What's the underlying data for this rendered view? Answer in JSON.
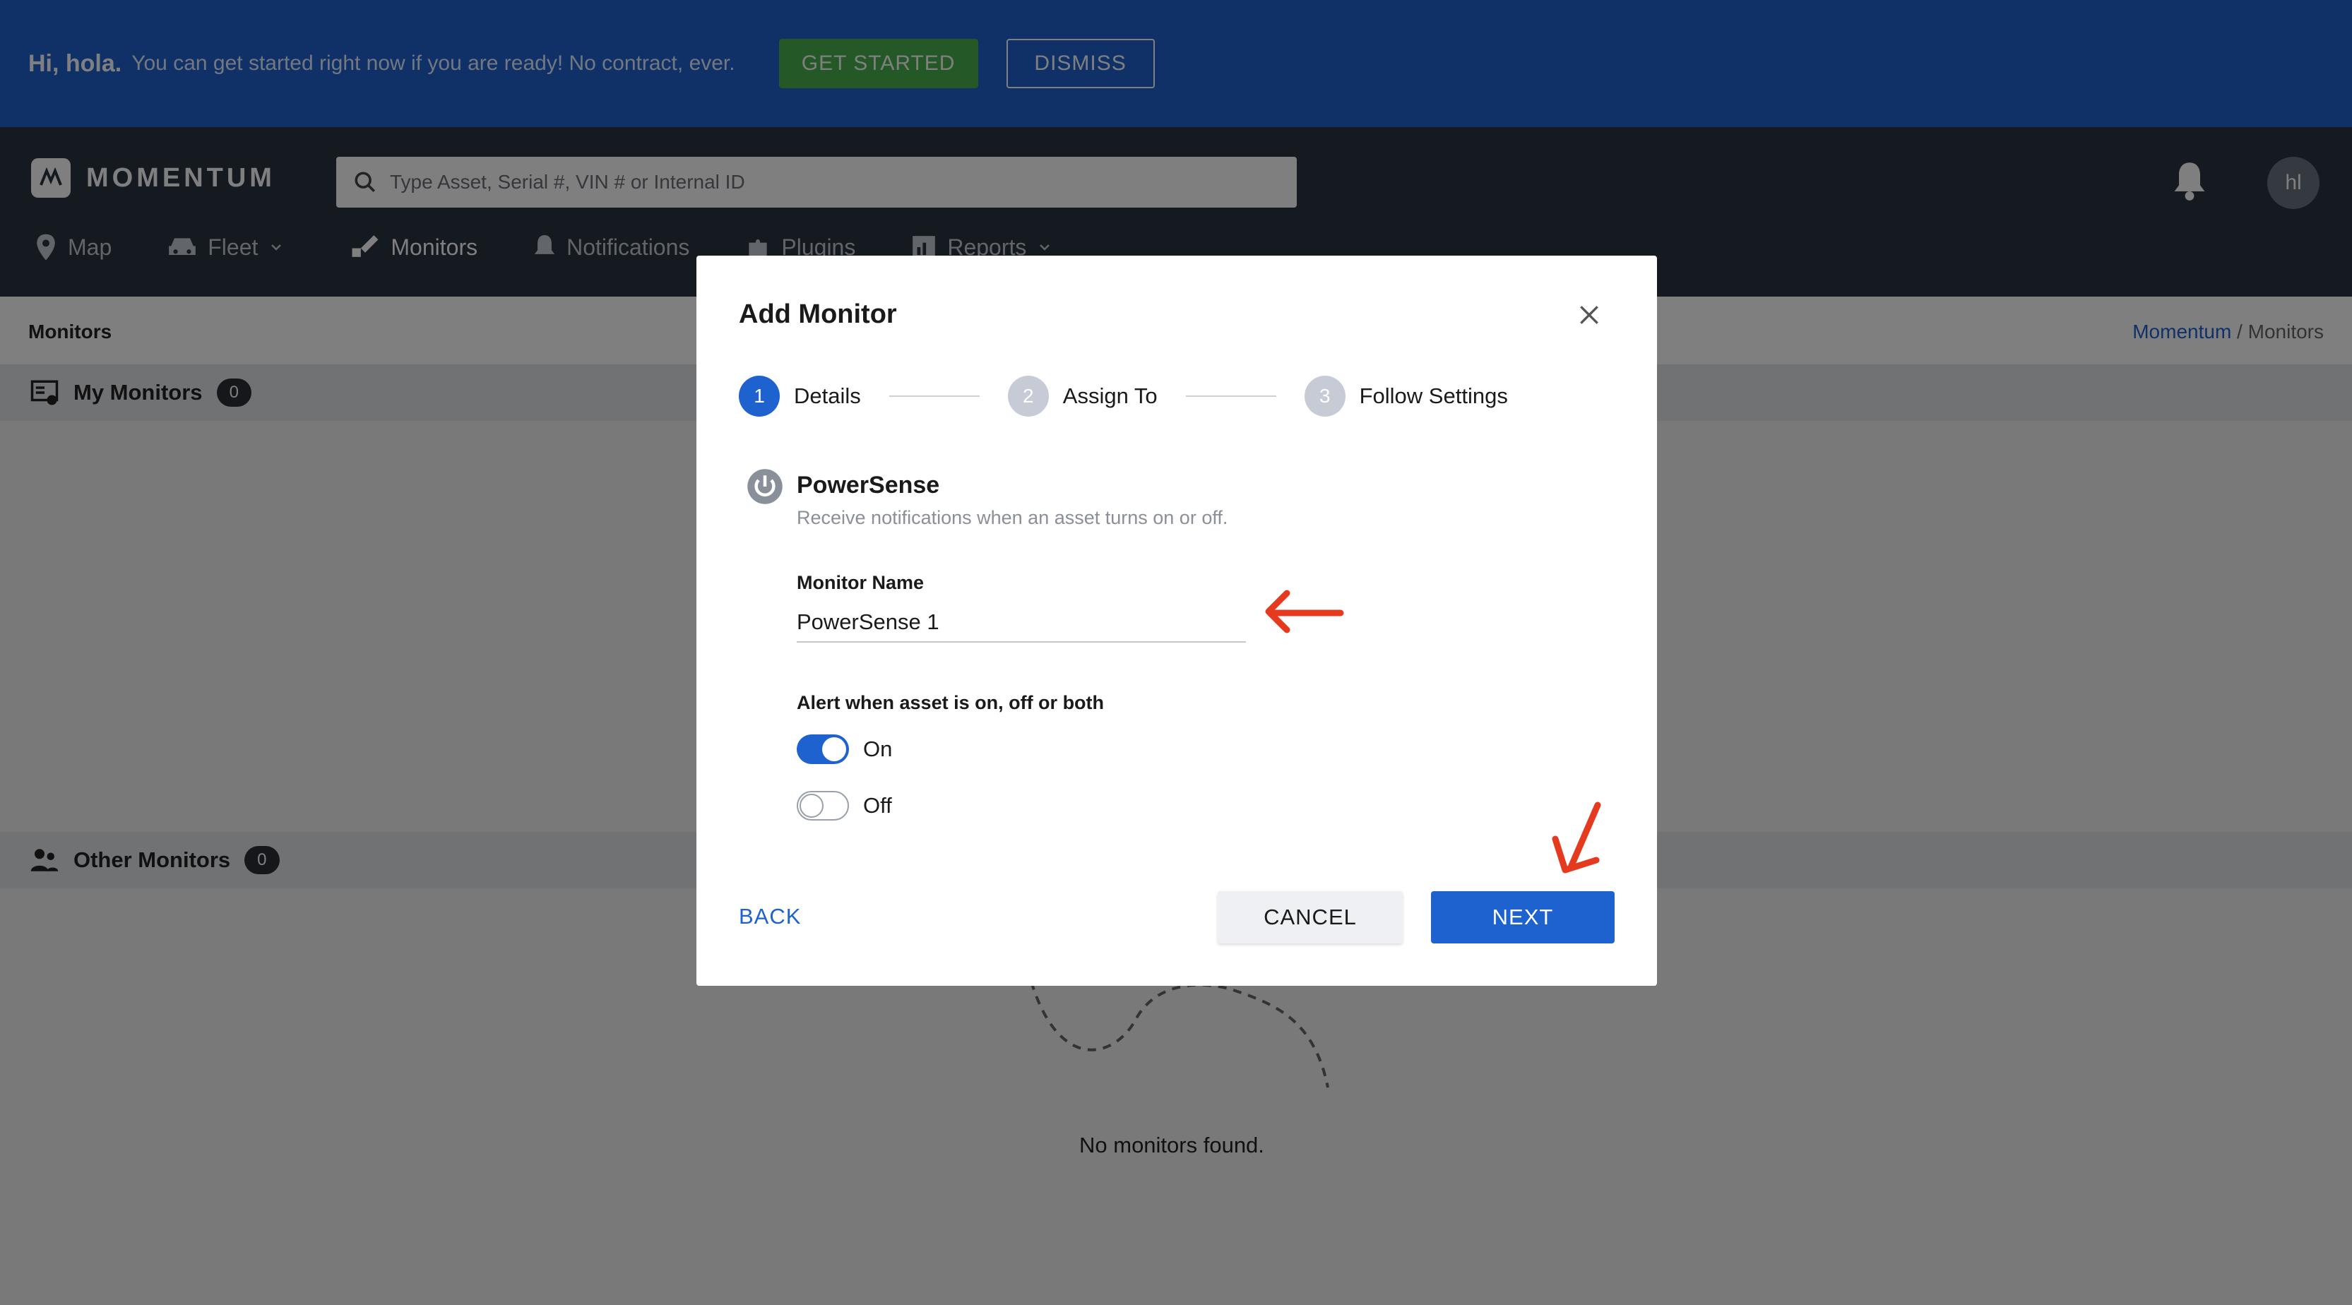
{
  "banner": {
    "greeting": "Hi, hola.",
    "message": "You can get started right now if you are ready! No contract, ever.",
    "get_started": "GET STARTED",
    "dismiss": "DISMISS"
  },
  "header": {
    "brand": "MOMENTUM",
    "search_placeholder": "Type Asset, Serial #, VIN # or Internal ID",
    "avatar_initials": "hl"
  },
  "nav": {
    "items": [
      {
        "label": "Map",
        "icon": "map-pin-icon"
      },
      {
        "label": "Fleet",
        "icon": "car-icon"
      },
      {
        "label": "Monitors",
        "icon": "monitors-icon"
      },
      {
        "label": "Notifications",
        "icon": "bell-icon"
      },
      {
        "label": "Plugins",
        "icon": "puzzle-icon"
      },
      {
        "label": "Reports",
        "icon": "chart-icon"
      }
    ]
  },
  "page": {
    "title": "Monitors",
    "breadcrumb_link": "Momentum",
    "breadcrumb_sep": " / ",
    "breadcrumb_current": "Monitors",
    "my_monitors": "My Monitors",
    "my_monitors_count": "0",
    "other_monitors": "Other Monitors",
    "other_monitors_count": "0",
    "empty": "No monitors found."
  },
  "modal": {
    "title": "Add Monitor",
    "steps": [
      {
        "num": "1",
        "label": "Details"
      },
      {
        "num": "2",
        "label": "Assign To"
      },
      {
        "num": "3",
        "label": "Follow Settings"
      }
    ],
    "type_name": "PowerSense",
    "type_desc": "Receive notifications when an asset turns on or off.",
    "field_label": "Monitor Name",
    "field_value": "PowerSense 1",
    "alert_label": "Alert when asset is on, off or both",
    "toggle_on_label": "On",
    "toggle_off_label": "Off",
    "back": "BACK",
    "cancel": "CANCEL",
    "next": "NEXT"
  },
  "colors": {
    "primary": "#1e62d0",
    "banner": "#1e62d0",
    "header": "#2b3543",
    "get_started": "#49b04e",
    "annotation": "#e53a1e"
  }
}
